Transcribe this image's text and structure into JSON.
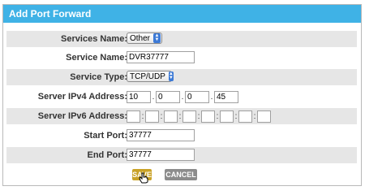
{
  "title": "Add Port Forward",
  "fields": {
    "services_name": {
      "label": "Services Name:",
      "value": "Other"
    },
    "service_name": {
      "label": "Service Name:",
      "value": "DVR37777"
    },
    "service_type": {
      "label": "Service Type:",
      "value": "TCP/UDP"
    },
    "ipv4": {
      "label": "Server IPv4 Address:",
      "octets": [
        "10",
        "0",
        "0",
        "45"
      ]
    },
    "ipv6": {
      "label": "Server IPv6 Address:",
      "segments": [
        "",
        "",
        "",
        "",
        "",
        "",
        "",
        ""
      ]
    },
    "start_port": {
      "label": "Start Port:",
      "value": "37777"
    },
    "end_port": {
      "label": "End Port:",
      "value": "37777"
    }
  },
  "buttons": {
    "save": "SAVE",
    "cancel": "CANCEL"
  },
  "colors": {
    "header": "#3fb2e6",
    "save": "#c9a227",
    "cancel": "#8c8c8c"
  }
}
